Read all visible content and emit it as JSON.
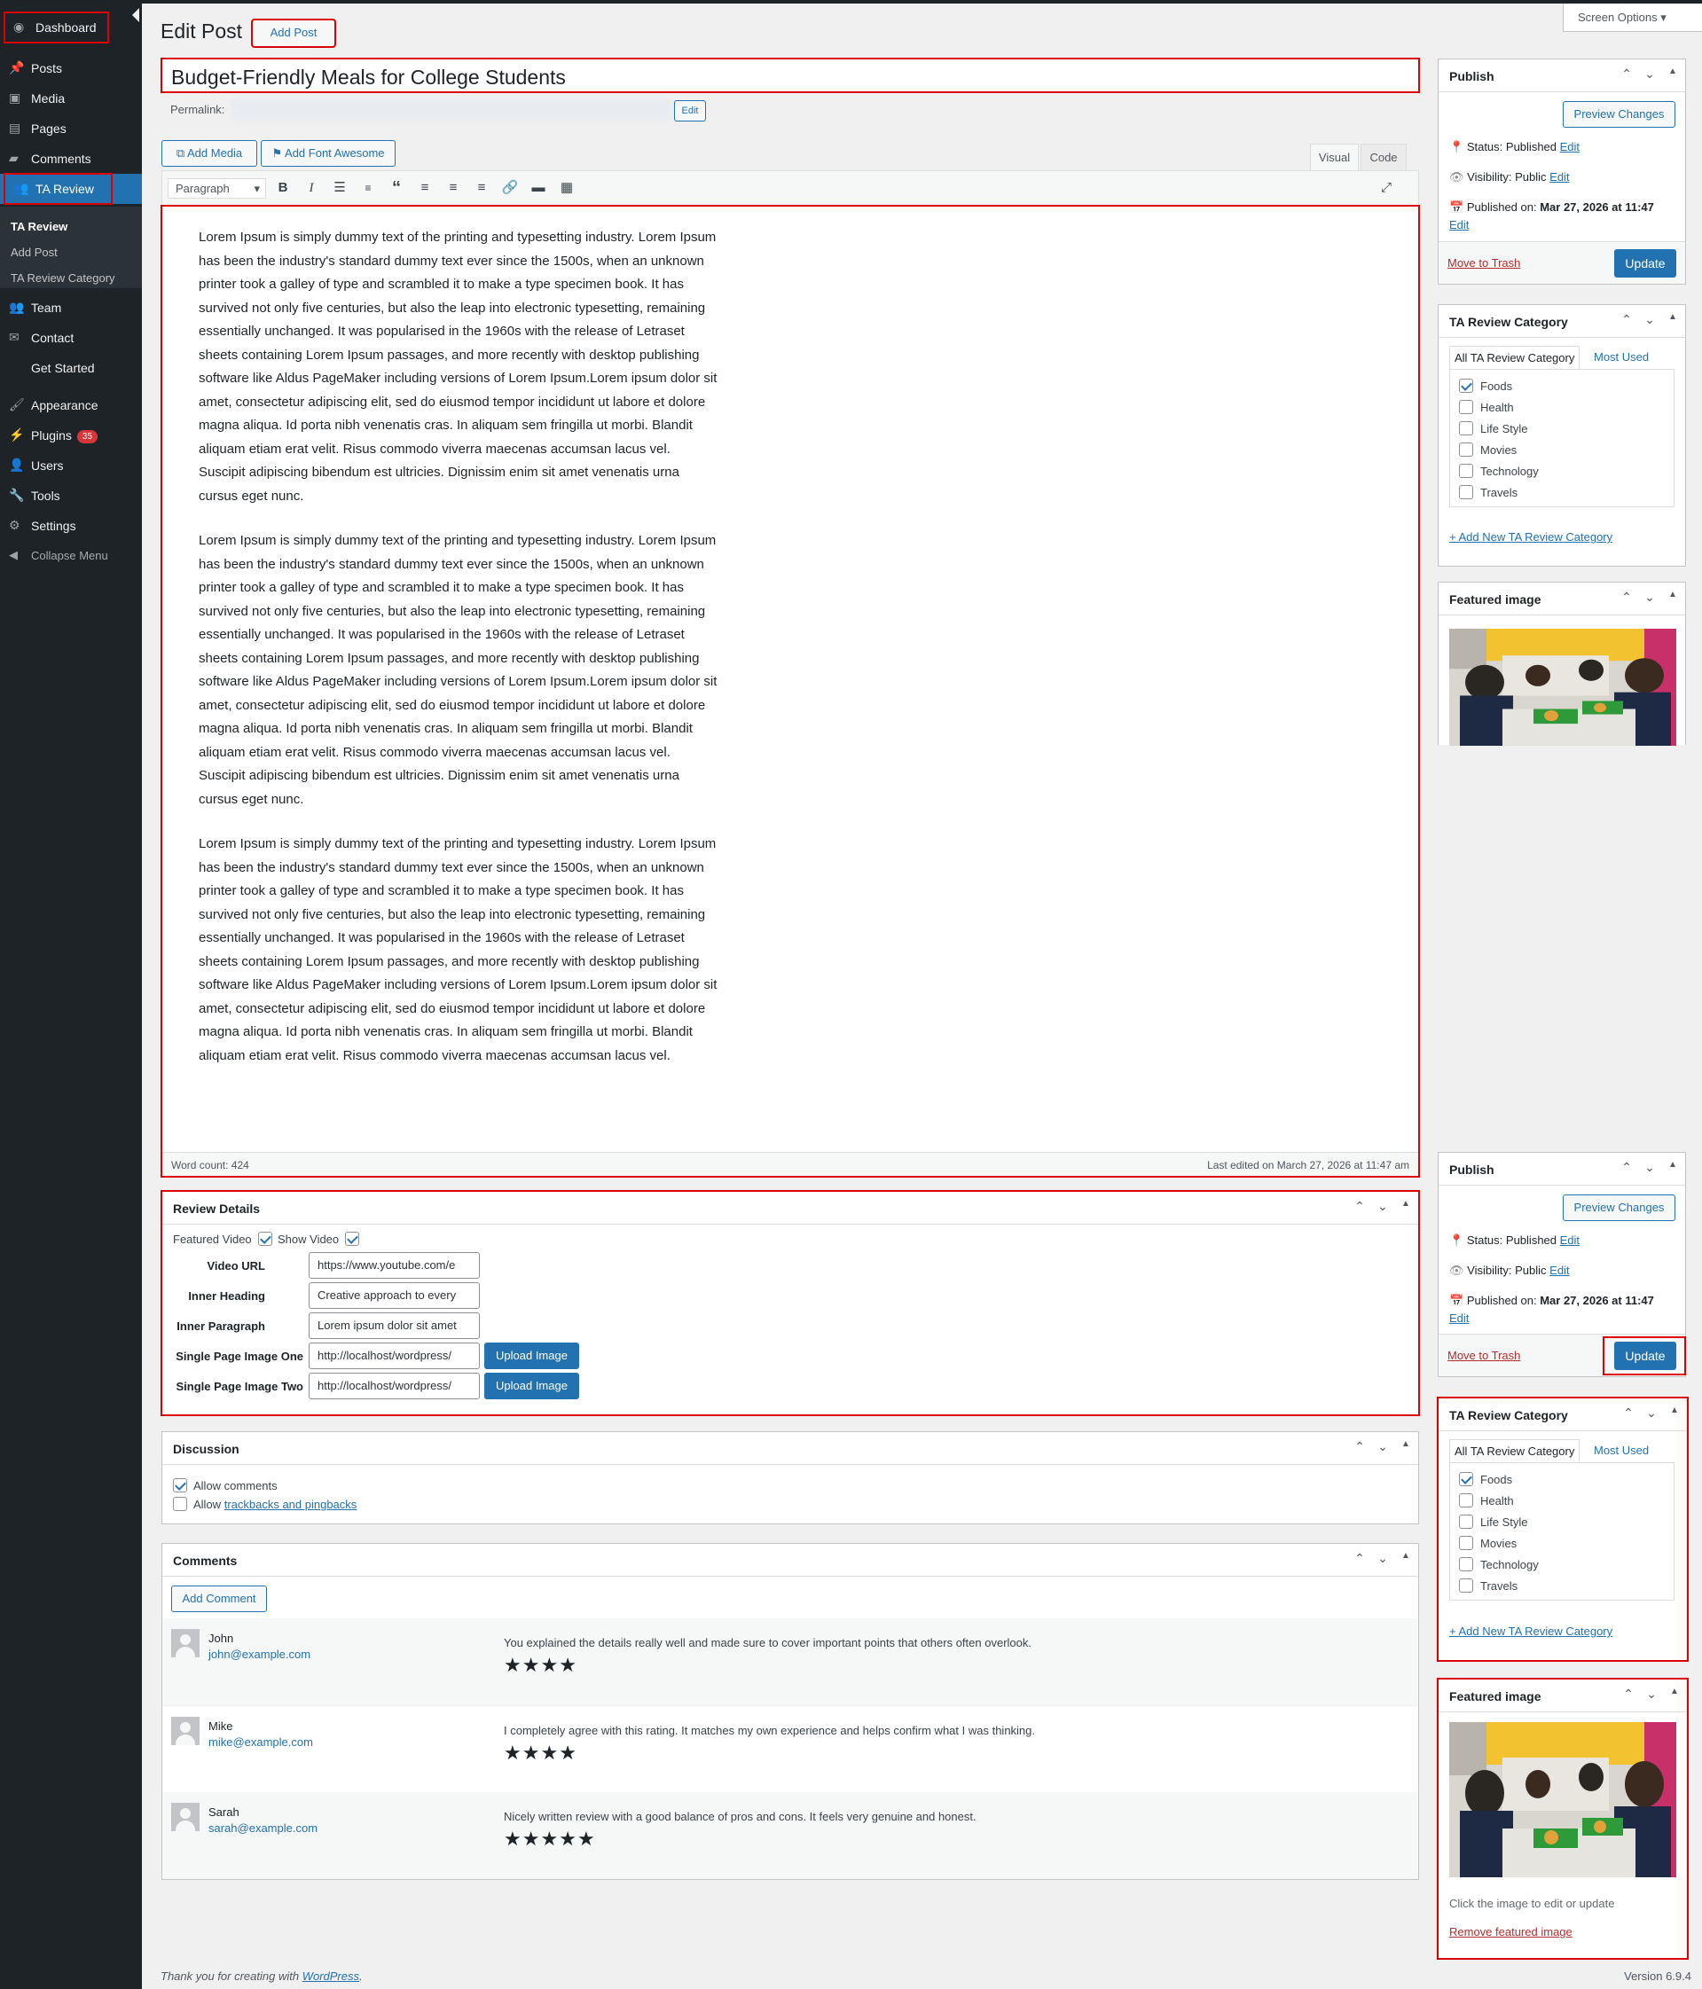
{
  "sidebar": {
    "items": [
      {
        "label": "Dashboard",
        "icon": "dashboard-icon"
      },
      {
        "label": "Posts",
        "icon": "pin-icon"
      },
      {
        "label": "Media",
        "icon": "media-icon"
      },
      {
        "label": "Pages",
        "icon": "pages-icon"
      },
      {
        "label": "Comments",
        "icon": "comments-icon"
      },
      {
        "label": "TA Review",
        "icon": "users-icon"
      },
      {
        "label": "Team",
        "icon": "users-icon"
      },
      {
        "label": "Contact",
        "icon": "email-icon"
      },
      {
        "label": "Get Started",
        "icon": ""
      },
      {
        "label": "Appearance",
        "icon": "brush-icon"
      },
      {
        "label": "Plugins",
        "icon": "plug-icon",
        "badge": "35"
      },
      {
        "label": "Users",
        "icon": "user-icon"
      },
      {
        "label": "Tools",
        "icon": "wrench-icon"
      },
      {
        "label": "Settings",
        "icon": "settings-icon"
      },
      {
        "label": "Collapse Menu",
        "icon": "collapse-icon"
      }
    ],
    "submenu": [
      "TA Review",
      "Add Post",
      "TA Review Category"
    ]
  },
  "header": {
    "title": "Edit Post",
    "add_post": "Add Post",
    "screen_options": "Screen Options"
  },
  "post": {
    "title": "Budget-Friendly Meals for College Students",
    "permalink_label": "Permalink:",
    "edit": "Edit"
  },
  "editor": {
    "add_media": "Add Media",
    "add_font_awesome": "Add Font Awesome",
    "tab_visual": "Visual",
    "tab_code": "Code",
    "format": "Paragraph",
    "paragraphs": [
      "Lorem Ipsum is simply dummy text of the printing and typesetting industry. Lorem Ipsum has been the industry's standard dummy text ever since the 1500s, when an unknown printer took a galley of type and scrambled it to make a type specimen book. It has survived not only five centuries, but also the leap into electronic typesetting, remaining essentially unchanged. It was popularised in the 1960s with the release of Letraset sheets containing Lorem Ipsum passages, and more recently with desktop publishing software like Aldus PageMaker including versions of Lorem Ipsum.Lorem ipsum dolor sit amet, consectetur adipiscing elit, sed do eiusmod tempor incididunt ut labore et dolore magna aliqua. Id porta nibh venenatis cras. In aliquam sem fringilla ut morbi. Blandit aliquam etiam erat velit. Risus commodo viverra maecenas accumsan lacus vel. Suscipit adipiscing bibendum est ultricies. Dignissim enim sit amet venenatis urna cursus eget nunc.",
      "Lorem Ipsum is simply dummy text of the printing and typesetting industry. Lorem Ipsum has been the industry's standard dummy text ever since the 1500s, when an unknown printer took a galley of type and scrambled it to make a type specimen book. It has survived not only five centuries, but also the leap into electronic typesetting, remaining essentially unchanged. It was popularised in the 1960s with the release of Letraset sheets containing Lorem Ipsum passages, and more recently with desktop publishing software like Aldus PageMaker including versions of Lorem Ipsum.Lorem ipsum dolor sit amet, consectetur adipiscing elit, sed do eiusmod tempor incididunt ut labore et dolore magna aliqua. Id porta nibh venenatis cras. In aliquam sem fringilla ut morbi. Blandit aliquam etiam erat velit. Risus commodo viverra maecenas accumsan lacus vel. Suscipit adipiscing bibendum est ultricies. Dignissim enim sit amet venenatis urna cursus eget nunc.",
      "Lorem Ipsum is simply dummy text of the printing and typesetting industry. Lorem Ipsum has been the industry's standard dummy text ever since the 1500s, when an unknown printer took a galley of type and scrambled it to make a type specimen book. It has survived not only five centuries, but also the leap into electronic typesetting, remaining essentially unchanged. It was popularised in the 1960s with the release of Letraset sheets containing Lorem Ipsum passages, and more recently with desktop publishing software like Aldus PageMaker including versions of Lorem Ipsum.Lorem ipsum dolor sit amet, consectetur adipiscing elit, sed do eiusmod tempor incididunt ut labore et dolore magna aliqua. Id porta nibh venenatis cras. In aliquam sem fringilla ut morbi. Blandit aliquam etiam erat velit. Risus commodo viverra maecenas accumsan lacus vel."
    ],
    "word_count": "Word count: 424",
    "last_edited": "Last edited on March 27, 2026 at 11:47 am"
  },
  "review": {
    "title": "Review Details",
    "featured_video": "Featured Video",
    "show_video": "Show Video",
    "fields": [
      {
        "label": "Video URL",
        "value": "https://www.youtube.com/e"
      },
      {
        "label": "Inner Heading",
        "value": "Creative approach to every"
      },
      {
        "label": "Inner Paragraph",
        "value": "Lorem ipsum dolor sit amet"
      },
      {
        "label": "Single Page Image One",
        "value": "http://localhost/wordpress/",
        "button": "Upload Image"
      },
      {
        "label": "Single Page Image Two",
        "value": "http://localhost/wordpress/",
        "button": "Upload Image"
      }
    ]
  },
  "discussion": {
    "title": "Discussion",
    "allow_comments": "Allow comments",
    "allow_prefix": "Allow",
    "trackbacks": "trackbacks and pingbacks"
  },
  "comments": {
    "title": "Comments",
    "add": "Add Comment",
    "items": [
      {
        "name": "John",
        "email": "john@example.com",
        "text": "You explained the details really well and made sure to cover important points that others often overlook.",
        "rating": 4
      },
      {
        "name": "Mike",
        "email": "mike@example.com",
        "text": "I completely agree with this rating. It matches my own experience and helps confirm what I was thinking.",
        "rating": 4
      },
      {
        "name": "Sarah",
        "email": "sarah@example.com",
        "text": "Nicely written review with a good balance of pros and cons. It feels very genuine and honest.",
        "rating": 5
      }
    ]
  },
  "publish": {
    "title": "Publish",
    "preview": "Preview Changes",
    "status_label": "Status:",
    "status_value": "Published",
    "visibility_label": "Visibility:",
    "visibility_value": "Public",
    "published_label": "Published on:",
    "published_value": "Mar 27, 2026 at 11:47",
    "edit": "Edit",
    "trash": "Move to Trash",
    "update": "Update"
  },
  "category": {
    "title": "TA Review Category",
    "tab_all": "All TA Review Category",
    "tab_most": "Most Used",
    "items": [
      {
        "label": "Foods",
        "checked": true
      },
      {
        "label": "Health",
        "checked": false
      },
      {
        "label": "Life Style",
        "checked": false
      },
      {
        "label": "Movies",
        "checked": false
      },
      {
        "label": "Technology",
        "checked": false
      },
      {
        "label": "Travels",
        "checked": false
      }
    ],
    "add_new": "+ Add New TA Review Category"
  },
  "featured": {
    "title": "Featured image",
    "hint": "Click the image to edit or update",
    "remove": "Remove featured image"
  },
  "footer": {
    "thanks": "Thank you for creating with",
    "wp": "WordPress",
    "version": "Version 6.9.4"
  },
  "colors": {
    "accent": "#2271b1",
    "sidebar": "#1d2327",
    "highlight": "#dd0000",
    "badge": "#d63638"
  }
}
